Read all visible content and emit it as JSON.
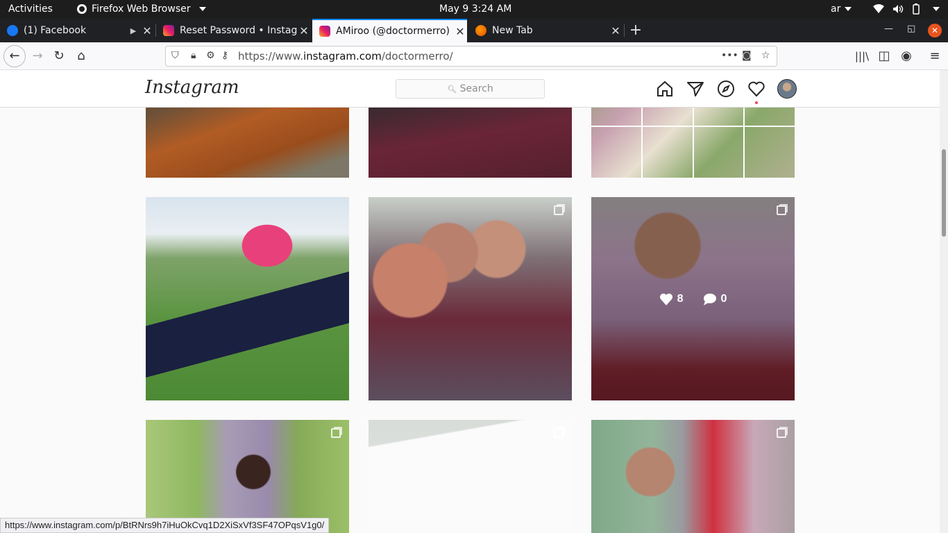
{
  "topbar": {
    "activities": "Activities",
    "app": "Firefox Web Browser",
    "clock": "May 9   3:24 AM",
    "lang": "ar"
  },
  "tabs": [
    {
      "title": "(1) Facebook"
    },
    {
      "title": "Reset Password • Instagram"
    },
    {
      "title": "ÁMiroo (@doctormerro) • Instagram"
    },
    {
      "title": "New Tab"
    }
  ],
  "url": {
    "prefix": "https://www.",
    "domain": "instagram.com",
    "path": "/doctormerro/"
  },
  "instagram": {
    "logo": "Instagram",
    "search_placeholder": "Search",
    "hover_post": {
      "likes": "8",
      "comments": "0"
    }
  },
  "status_url": "https://www.instagram.com/p/BtRNrs9h7iHuOkCvq1D2XiSxVf3SF47OPqsV1g0/",
  "colors": {
    "accent": "#0a84ff",
    "brand": "#262626",
    "notification": "#ed4956",
    "ubuntu_orange": "#e95420"
  }
}
